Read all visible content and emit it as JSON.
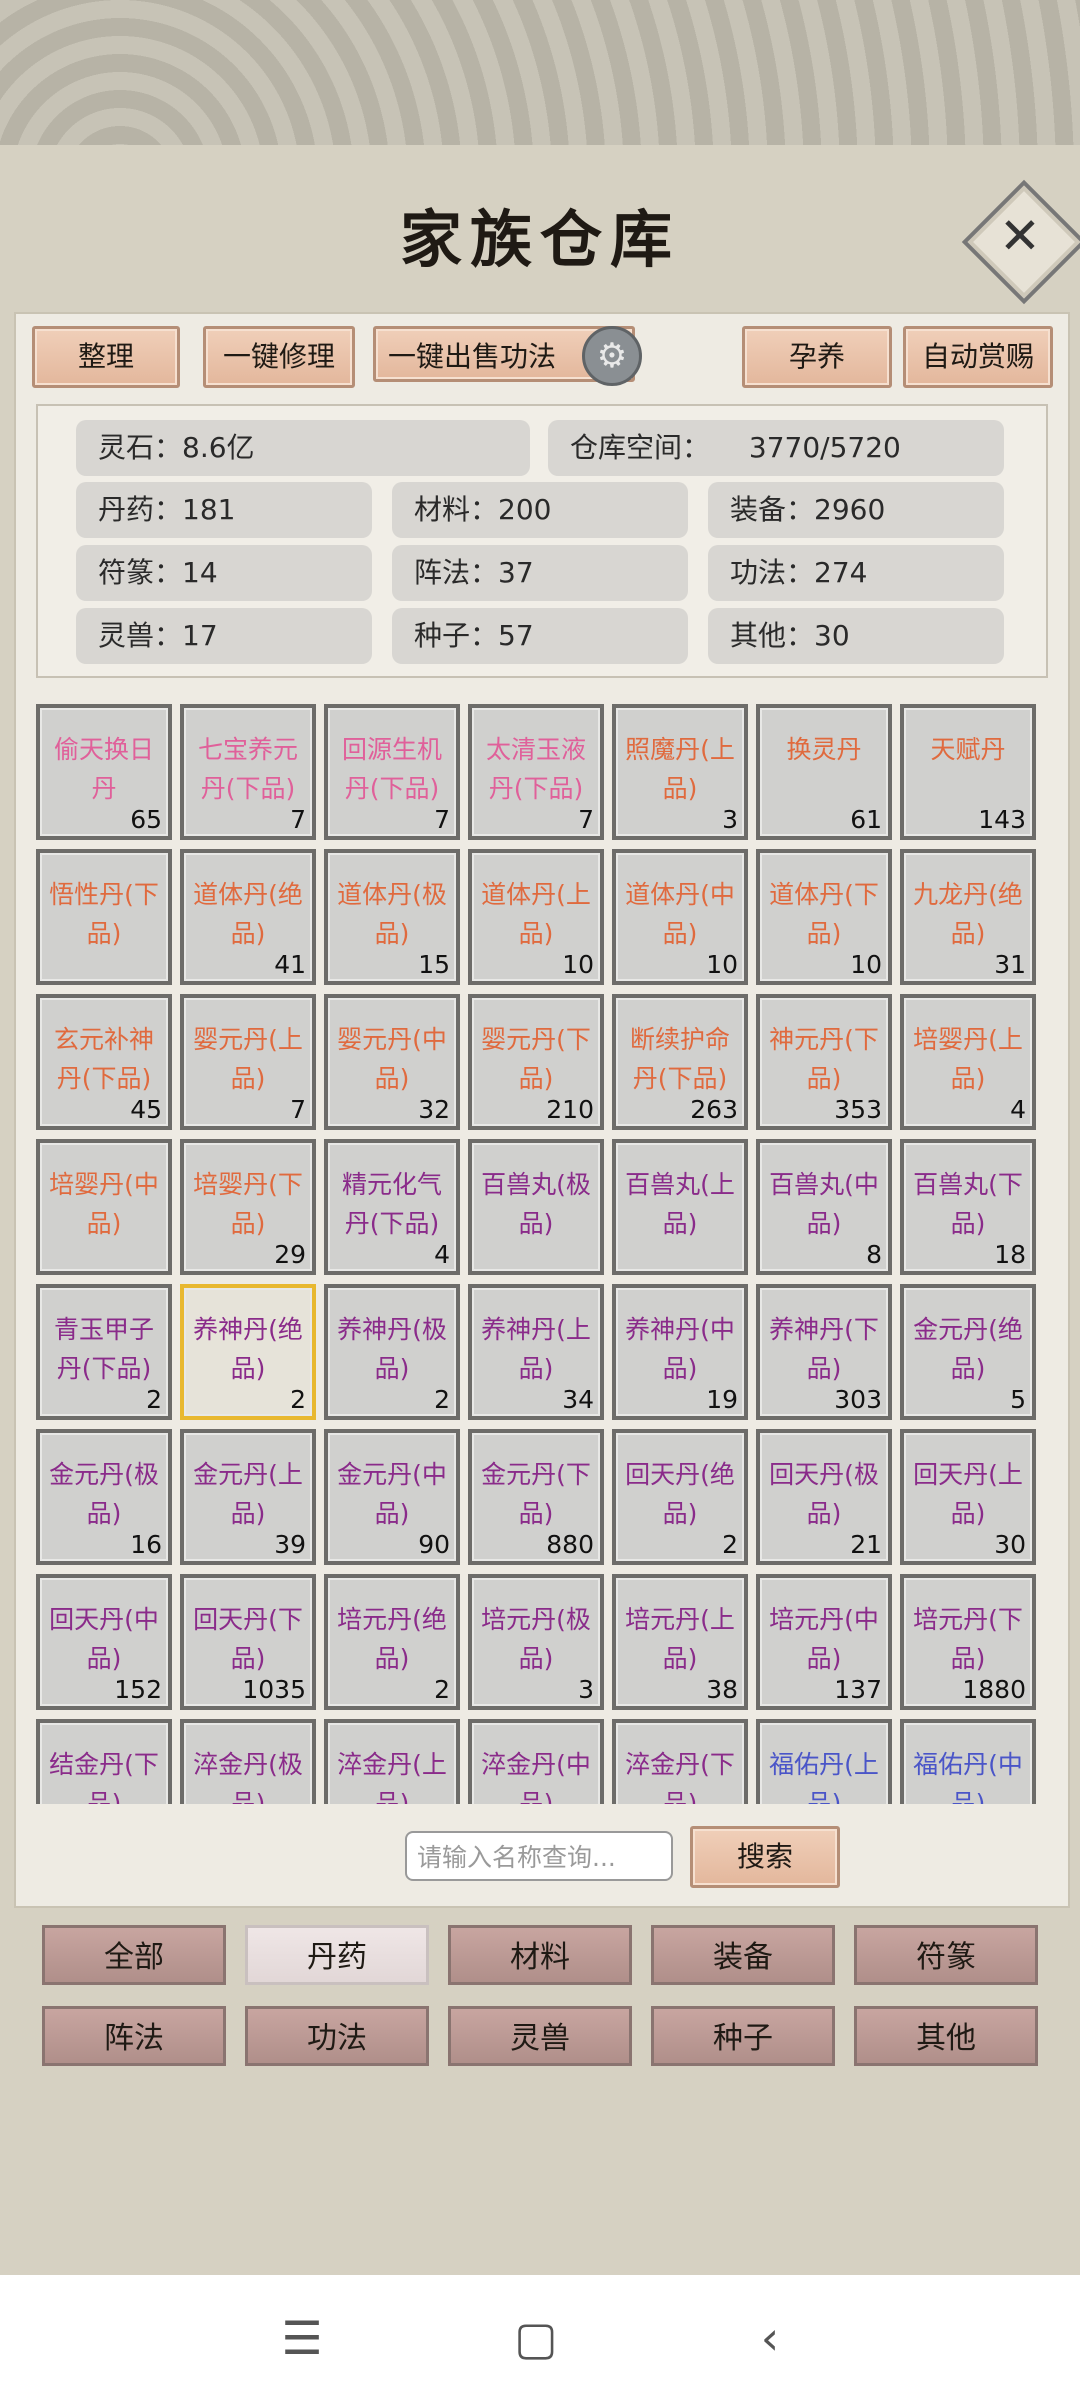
{
  "title": "家族仓库",
  "toolbar": {
    "organize": "整理",
    "repair_all": "一键修理",
    "sell_skills": "一键出售功法",
    "nurture": "孕养",
    "auto_reward": "自动赏赐"
  },
  "stats": {
    "spirit_stone": "灵石：8.6亿",
    "storage_label": "仓库空间：",
    "storage_value": "3770/5720",
    "pills": "丹药：181",
    "materials": "材料：200",
    "equipment": "装备：2960",
    "talismans": "符篆：14",
    "formations": "阵法：37",
    "skills": "功法：274",
    "beasts": "灵兽：17",
    "seeds": "种子：57",
    "others": "其他：30"
  },
  "items": [
    {
      "name": "偷天换日丹",
      "count": "65",
      "color": "#e0609a"
    },
    {
      "name": "七宝养元丹(下品)",
      "count": "7",
      "color": "#e0609a"
    },
    {
      "name": "回源生机丹(下品)",
      "count": "7",
      "color": "#e0609a"
    },
    {
      "name": "太清玉液丹(下品)",
      "count": "7",
      "color": "#e0609a"
    },
    {
      "name": "照魔丹(上品)",
      "count": "3",
      "color": "#e06a3e"
    },
    {
      "name": "换灵丹",
      "count": "61",
      "color": "#e06a3e"
    },
    {
      "name": "天赋丹",
      "count": "143",
      "color": "#e06a3e"
    },
    {
      "name": "悟性丹(下品)",
      "count": "",
      "color": "#e06a3e"
    },
    {
      "name": "道体丹(绝品)",
      "count": "41",
      "color": "#e06a3e"
    },
    {
      "name": "道体丹(极品)",
      "count": "15",
      "color": "#e06a3e"
    },
    {
      "name": "道体丹(上品)",
      "count": "10",
      "color": "#e06a3e"
    },
    {
      "name": "道体丹(中品)",
      "count": "10",
      "color": "#e06a3e"
    },
    {
      "name": "道体丹(下品)",
      "count": "10",
      "color": "#e06a3e"
    },
    {
      "name": "九龙丹(绝品)",
      "count": "31",
      "color": "#e06a3e"
    },
    {
      "name": "玄元补神丹(下品)",
      "count": "45",
      "color": "#e06a3e"
    },
    {
      "name": "婴元丹(上品)",
      "count": "7",
      "color": "#e06a3e"
    },
    {
      "name": "婴元丹(中品)",
      "count": "32",
      "color": "#e06a3e"
    },
    {
      "name": "婴元丹(下品)",
      "count": "210",
      "color": "#e06a3e"
    },
    {
      "name": "断续护命丹(下品)",
      "count": "263",
      "color": "#e06a3e"
    },
    {
      "name": "神元丹(下品)",
      "count": "353",
      "color": "#e06a3e"
    },
    {
      "name": "培婴丹(上品)",
      "count": "4",
      "color": "#e06a3e"
    },
    {
      "name": "培婴丹(中品)",
      "count": "",
      "color": "#e06a3e"
    },
    {
      "name": "培婴丹(下品)",
      "count": "29",
      "color": "#e06a3e"
    },
    {
      "name": "精元化气丹(下品)",
      "count": "4",
      "color": "#8a2b8a"
    },
    {
      "name": "百兽丸(极品)",
      "count": "",
      "color": "#8a2b8a"
    },
    {
      "name": "百兽丸(上品)",
      "count": "",
      "color": "#8a2b8a"
    },
    {
      "name": "百兽丸(中品)",
      "count": "8",
      "color": "#8a2b8a"
    },
    {
      "name": "百兽丸(下品)",
      "count": "18",
      "color": "#8a2b8a"
    },
    {
      "name": "青玉甲子丹(下品)",
      "count": "2",
      "color": "#8a2b8a"
    },
    {
      "name": "养神丹(绝品)",
      "count": "2",
      "color": "#8a2b8a",
      "selected": true
    },
    {
      "name": "养神丹(极品)",
      "count": "2",
      "color": "#8a2b8a"
    },
    {
      "name": "养神丹(上品)",
      "count": "34",
      "color": "#8a2b8a"
    },
    {
      "name": "养神丹(中品)",
      "count": "19",
      "color": "#8a2b8a"
    },
    {
      "name": "养神丹(下品)",
      "count": "303",
      "color": "#8a2b8a"
    },
    {
      "name": "金元丹(绝品)",
      "count": "5",
      "color": "#8a2b8a"
    },
    {
      "name": "金元丹(极品)",
      "count": "16",
      "color": "#8a2b8a"
    },
    {
      "name": "金元丹(上品)",
      "count": "39",
      "color": "#8a2b8a"
    },
    {
      "name": "金元丹(中品)",
      "count": "90",
      "color": "#8a2b8a"
    },
    {
      "name": "金元丹(下品)",
      "count": "880",
      "color": "#8a2b8a"
    },
    {
      "name": "回天丹(绝品)",
      "count": "2",
      "color": "#8a2b8a"
    },
    {
      "name": "回天丹(极品)",
      "count": "21",
      "color": "#8a2b8a"
    },
    {
      "name": "回天丹(上品)",
      "count": "30",
      "color": "#8a2b8a"
    },
    {
      "name": "回天丹(中品)",
      "count": "152",
      "color": "#8a2b8a"
    },
    {
      "name": "回天丹(下品)",
      "count": "1035",
      "color": "#8a2b8a"
    },
    {
      "name": "培元丹(绝品)",
      "count": "2",
      "color": "#8a2b8a"
    },
    {
      "name": "培元丹(极品)",
      "count": "3",
      "color": "#8a2b8a"
    },
    {
      "name": "培元丹(上品)",
      "count": "38",
      "color": "#8a2b8a"
    },
    {
      "name": "培元丹(中品)",
      "count": "137",
      "color": "#8a2b8a"
    },
    {
      "name": "培元丹(下品)",
      "count": "1880",
      "color": "#8a2b8a"
    },
    {
      "name": "结金丹(下品)",
      "count": "",
      "color": "#8a2b8a"
    },
    {
      "name": "淬金丹(极品)",
      "count": "",
      "color": "#8a2b8a"
    },
    {
      "name": "淬金丹(上品)",
      "count": "",
      "color": "#8a2b8a"
    },
    {
      "name": "淬金丹(中品)",
      "count": "",
      "color": "#8a2b8a"
    },
    {
      "name": "淬金丹(下品)",
      "count": "",
      "color": "#8a2b8a"
    },
    {
      "name": "福佑丹(上品)",
      "count": "",
      "color": "#4a55c8"
    },
    {
      "name": "福佑丹(中品)",
      "count": "",
      "color": "#4a55c8"
    }
  ],
  "search": {
    "placeholder": "请输入名称查询...",
    "button": "搜索"
  },
  "tabs": [
    "全部",
    "丹药",
    "材料",
    "装备",
    "符篆",
    "阵法",
    "功法",
    "灵兽",
    "种子",
    "其他"
  ],
  "active_tab": "丹药",
  "icons": {
    "close": "close-icon",
    "gear": "gear-icon",
    "nav_menu": "menu-icon",
    "nav_home": "home-icon",
    "nav_back": "back-icon"
  }
}
